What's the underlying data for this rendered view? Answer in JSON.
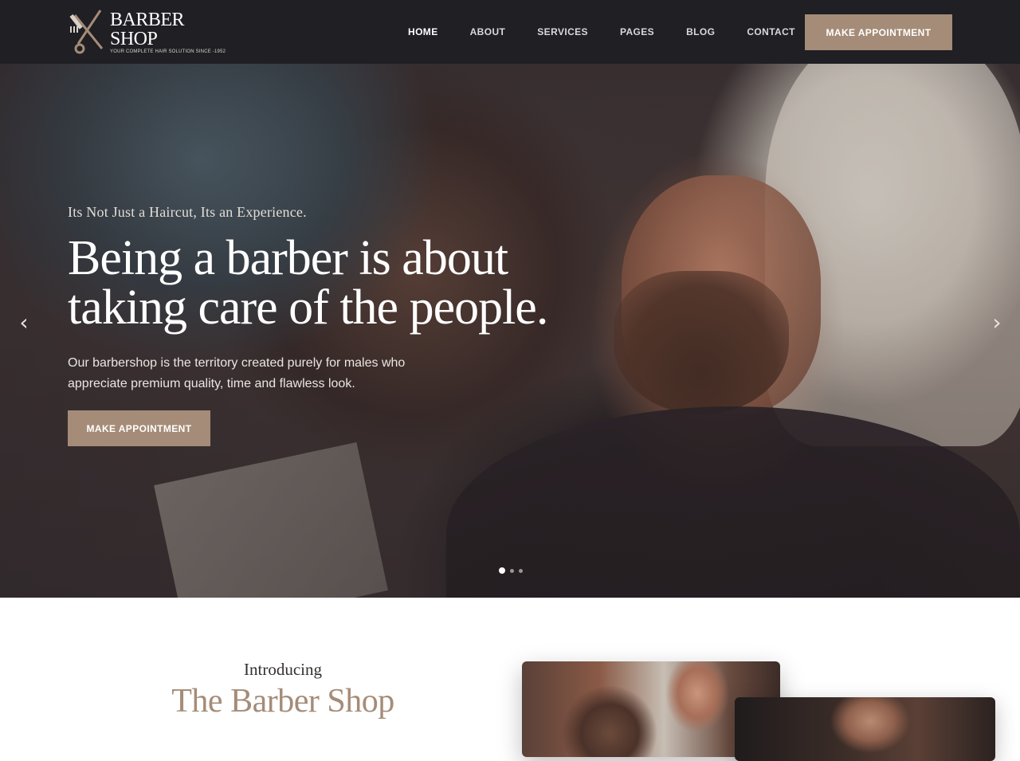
{
  "header": {
    "logo": {
      "title": "BARBER SHOP",
      "subtitle": "YOUR COMPLETE HAIR SOLUTION SINCE -1952"
    },
    "nav": [
      {
        "label": "HOME",
        "active": true
      },
      {
        "label": "ABOUT",
        "active": false
      },
      {
        "label": "SERVICES",
        "active": false
      },
      {
        "label": "PAGES",
        "active": false
      },
      {
        "label": "BLOG",
        "active": false
      },
      {
        "label": "CONTACT",
        "active": false
      }
    ],
    "cta_label": "MAKE APPOINTMENT"
  },
  "hero": {
    "tagline": "Its Not Just a Haircut, Its an Experience.",
    "headline_line1": "Being a barber is about",
    "headline_line2": "taking care of the people.",
    "description": "Our barbershop is the territory created purely for males who appreciate premium quality, time and flawless look.",
    "cta_label": "MAKE APPOINTMENT",
    "prev_icon": "chevron-left-icon",
    "next_icon": "chevron-right-icon",
    "slides_total": 3,
    "slide_active": 1
  },
  "intro": {
    "subtitle": "Introducing",
    "title": "The Barber Shop"
  },
  "colors": {
    "accent": "#a58c78",
    "header_bg": "#1f1f24",
    "text_dark": "#34302d"
  }
}
